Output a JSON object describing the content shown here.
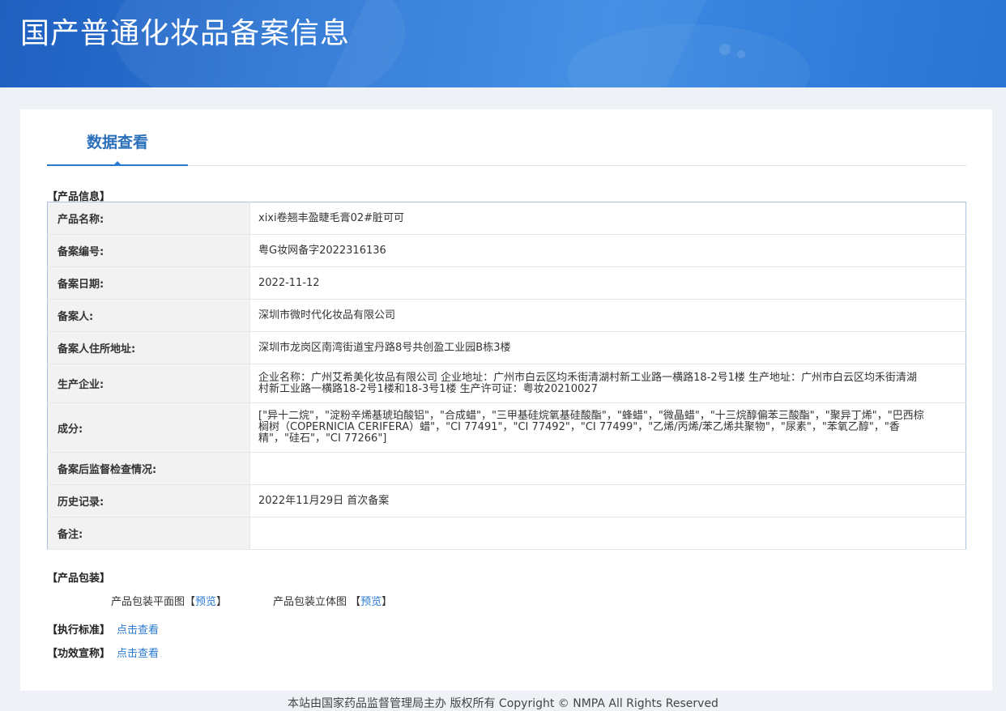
{
  "header": {
    "title": "国产普通化妆品备案信息"
  },
  "tab": {
    "label": "数据查看"
  },
  "product_info": {
    "title": "【产品信息】",
    "rows": [
      {
        "label": "产品名称:",
        "value": "xixi卷翘丰盈睫毛膏02#脏可可"
      },
      {
        "label": "备案编号:",
        "value": "粤G妆网备字2022316136"
      },
      {
        "label": "备案日期:",
        "value": "2022-11-12"
      },
      {
        "label": "备案人:",
        "value": "深圳市微时代化妆品有限公司"
      },
      {
        "label": "备案人住所地址:",
        "value": "深圳市龙岗区南湾街道宝丹路8号共创盈工业园B栋3楼"
      },
      {
        "label": "生产企业:",
        "value": "企业名称：广州艾希美化妆品有限公司 企业地址：广州市白云区均禾街清湖村新工业路一横路18-2号1楼 生产地址：广州市白云区均禾街清湖村新工业路一横路18-2号1楼和18-3号1楼 生产许可证：粤妆20210027"
      },
      {
        "label": "成分:",
        "value": "[\"异十二烷\"，\"淀粉辛烯基琥珀酸铝\"，\"合成蜡\"，\"三甲基硅烷氧基硅酸酯\"，\"蜂蜡\"，\"微晶蜡\"，\"十三烷醇偏苯三酸酯\"，\"聚异丁烯\"，\"巴西棕榈树（COPERNICIA CERIFERA）蜡\"，\"CI 77491\"，\"CI 77492\"，\"CI 77499\"，\"乙烯/丙烯/苯乙烯共聚物\"，\"尿素\"，\"苯氧乙醇\"，\"香精\"，\"硅石\"，\"CI 77266\"]"
      },
      {
        "label": "备案后监督检查情况:",
        "value": ""
      },
      {
        "label": "历史记录:",
        "value": "2022年11月29日 首次备案"
      },
      {
        "label": "备注:",
        "value": ""
      }
    ]
  },
  "packaging": {
    "title": "【产品包装】",
    "flat_label": "产品包装平面图",
    "flat_link": "预览",
    "solid_label": "产品包装立体图",
    "solid_link": "预览"
  },
  "standard": {
    "label": "【执行标准】",
    "link": "点击查看"
  },
  "efficacy": {
    "label": "【功效宣称】",
    "link": "点击查看"
  },
  "footer": {
    "text": "本站由国家药品监督管理局主办 版权所有 Copyright © NMPA All Rights Reserved"
  }
}
